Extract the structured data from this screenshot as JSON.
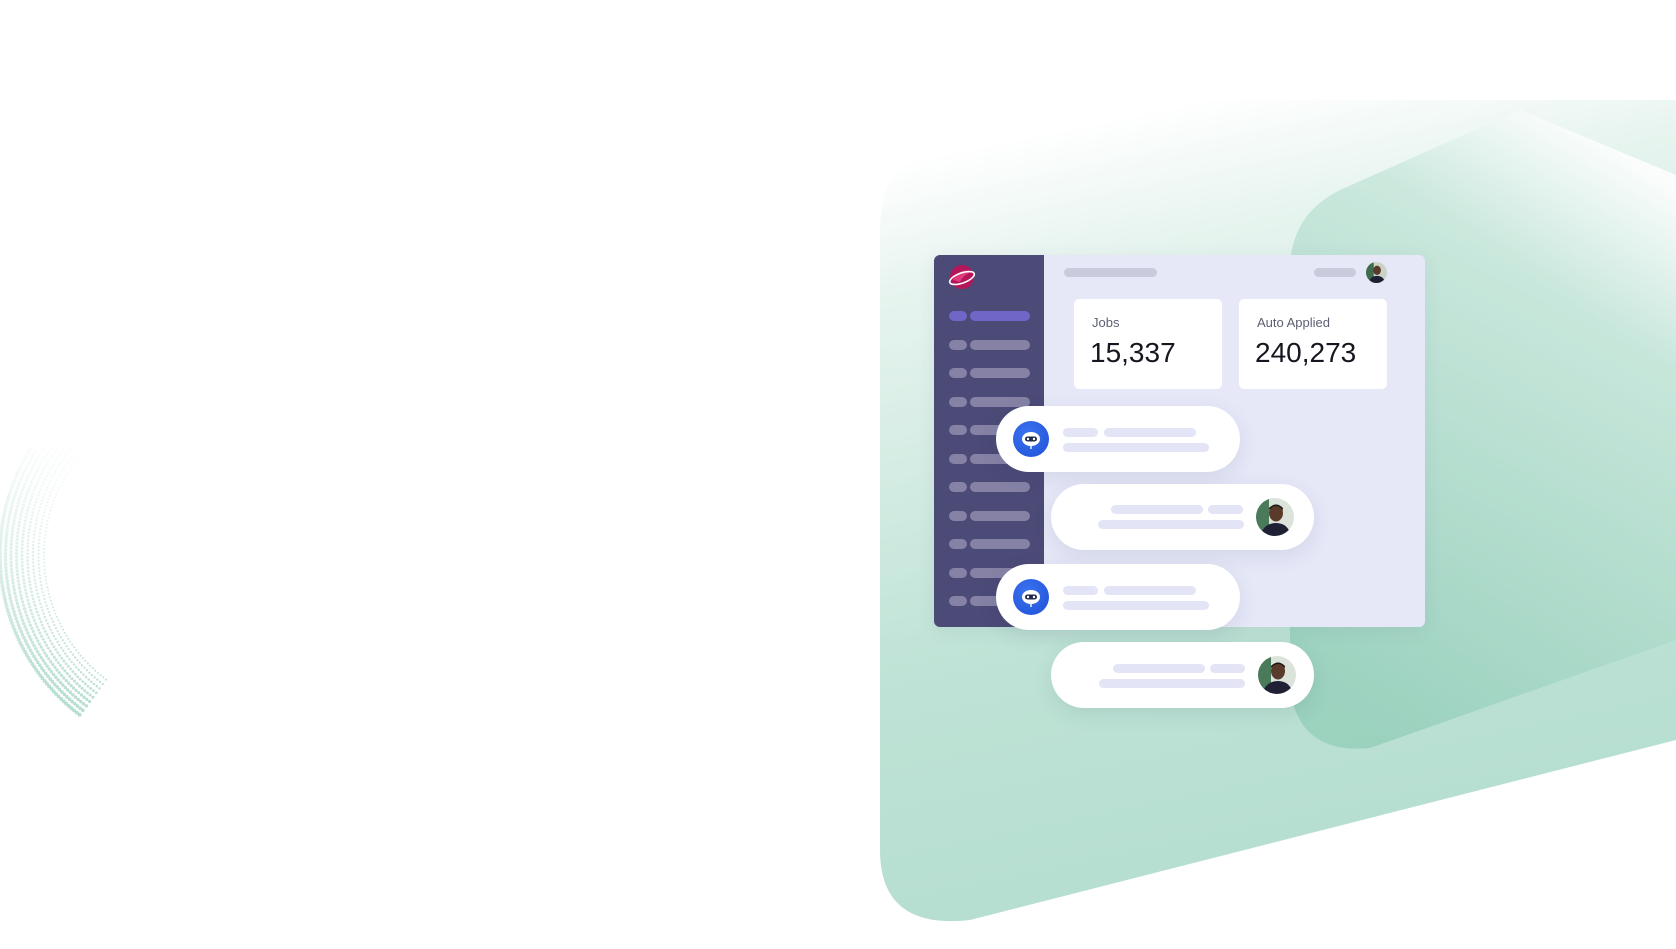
{
  "dashboard": {
    "stats": [
      {
        "label": "Jobs",
        "value": "15,337"
      },
      {
        "label": "Auto Applied",
        "value": "240,273"
      }
    ],
    "nav_item_count": 11
  },
  "chat": {
    "messages": [
      {
        "sender": "bot",
        "avatar_icon": "robot-icon"
      },
      {
        "sender": "user",
        "avatar_icon": "user-avatar"
      },
      {
        "sender": "bot",
        "avatar_icon": "robot-icon"
      },
      {
        "sender": "user",
        "avatar_icon": "user-avatar"
      }
    ]
  },
  "colors": {
    "sidebar": "#4c4a77",
    "nav_active": "#6f66c8",
    "panel_background": "#e6e8f8",
    "bot_avatar": "#2458e0",
    "background_shape": "#b9e0d3"
  }
}
